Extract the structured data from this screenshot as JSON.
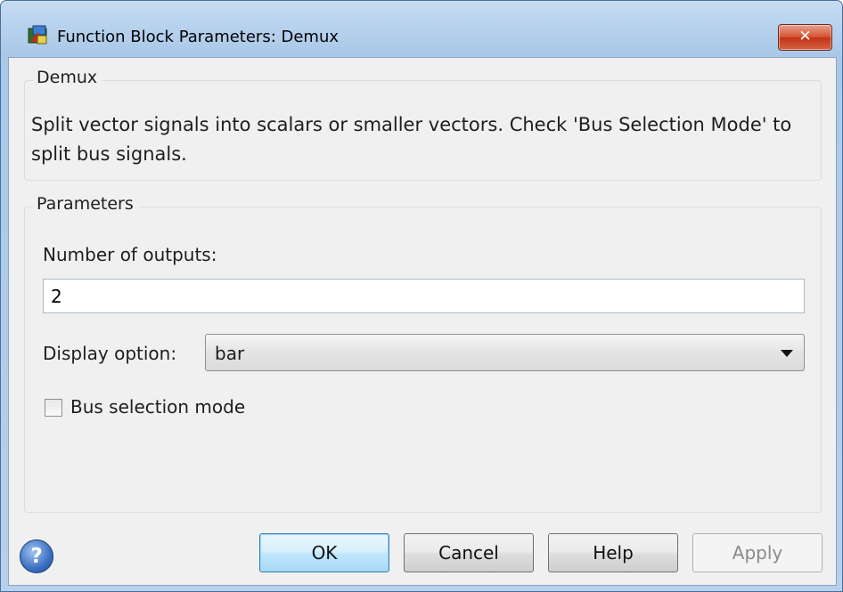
{
  "window": {
    "title": "Function Block Parameters: Demux",
    "close_glyph": "✕",
    "icon": "simulink-block-icon"
  },
  "description_group": {
    "title": "Demux",
    "text": "Split vector signals into scalars or smaller vectors. Check 'Bus Selection Mode' to split bus signals."
  },
  "parameters_group": {
    "title": "Parameters",
    "number_of_outputs_label": "Number of outputs:",
    "number_of_outputs_value": "2",
    "display_option_label": "Display option:",
    "display_option_value": "bar",
    "bus_selection_label": "Bus selection mode",
    "bus_selection_checked": false
  },
  "footer": {
    "help_icon_glyph": "?",
    "ok_label": "OK",
    "cancel_label": "Cancel",
    "help_label": "Help",
    "apply_label": "Apply"
  },
  "colors": {
    "close_button": "#d6552f",
    "default_button": "#bee6fd",
    "help_icon": "#3c6fc0"
  }
}
